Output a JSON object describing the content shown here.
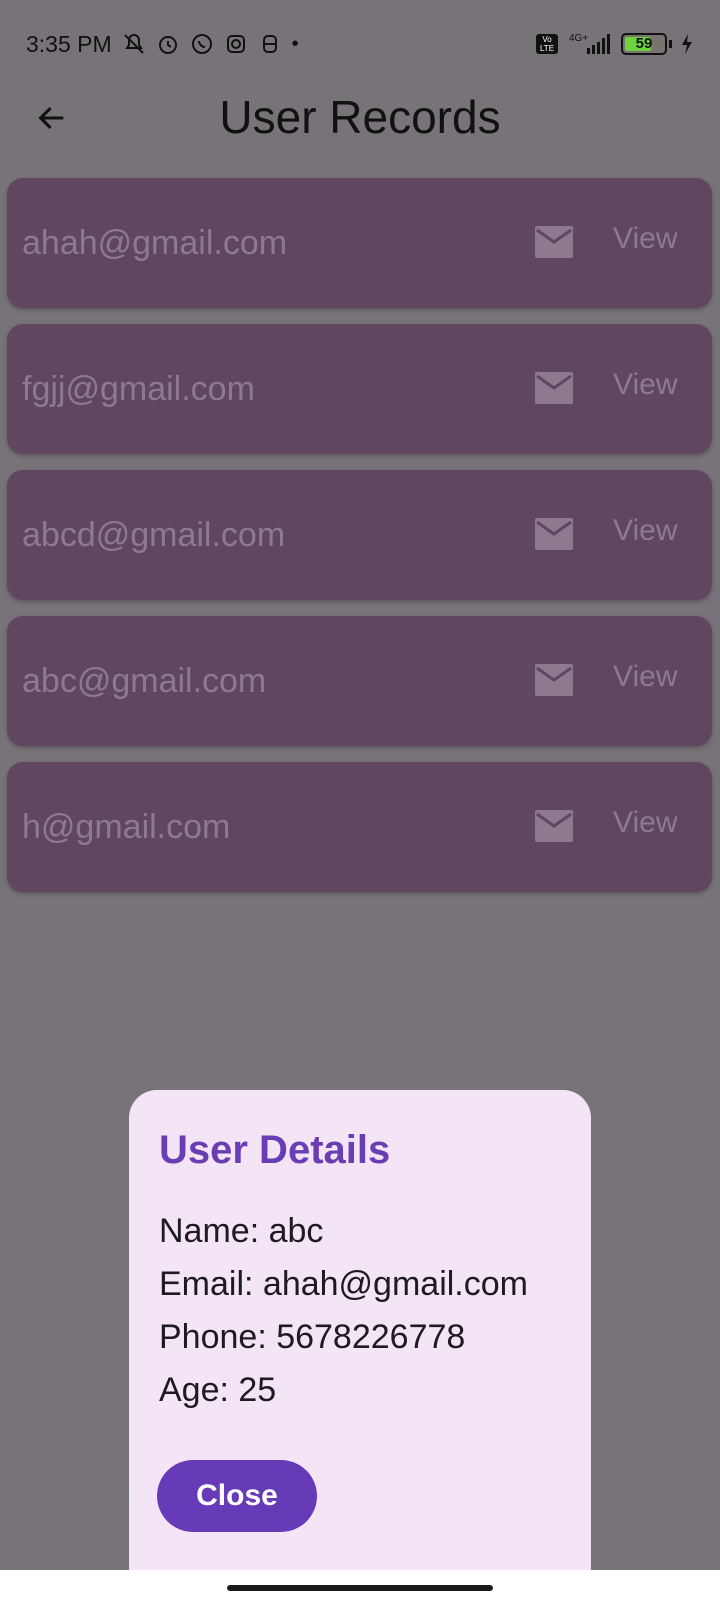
{
  "status_bar": {
    "time": "3:35 PM",
    "left_icons": [
      "mute-icon",
      "alarm-icon",
      "whatsapp-icon",
      "instagram-icon",
      "mask-icon",
      "dot-icon"
    ],
    "network": "4G+",
    "volte": "Vo LTE",
    "battery_level": "59"
  },
  "app_bar": {
    "title": "User Records",
    "back_icon": "arrow-left-icon"
  },
  "records": [
    {
      "email": "ahah@gmail.com",
      "action": "View"
    },
    {
      "email": "fgjj@gmail.com",
      "action": "View"
    },
    {
      "email": "abcd@gmail.com",
      "action": "View"
    },
    {
      "email": "abc@gmail.com",
      "action": "View"
    },
    {
      "email": "h@gmail.com",
      "action": "View"
    }
  ],
  "dialog": {
    "title": "User Details",
    "name": "Name: abc",
    "email": "Email: ahah@gmail.com",
    "phone": "Phone: 5678226778",
    "age": "Age: 25",
    "close_label": "Close"
  },
  "colors": {
    "scrim": "#787378",
    "card": "#604661",
    "dialog_bg": "#f3e5f5",
    "accent": "#673ab7"
  }
}
